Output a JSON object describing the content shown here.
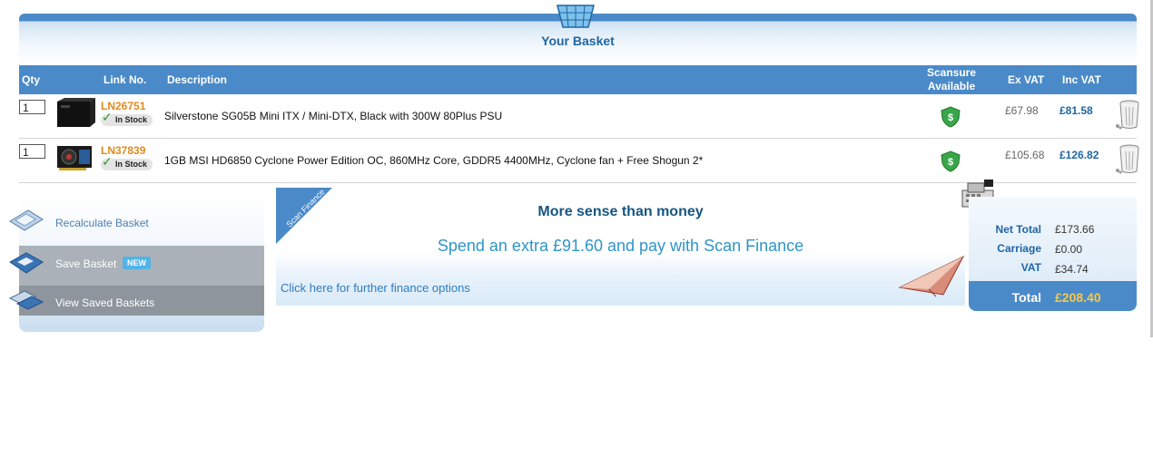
{
  "header": {
    "title": "Your Basket"
  },
  "table": {
    "columns": {
      "qty": "Qty",
      "link_no": "Link No.",
      "description": "Description",
      "scansure": "Scansure Available",
      "ex_vat": "Ex VAT",
      "inc_vat": "Inc VAT"
    },
    "rows": [
      {
        "qty": "1",
        "link_no": "LN26751",
        "stock": "In Stock",
        "description": "Silverstone SG05B Mini ITX / Mini-DTX, Black with 300W 80Plus PSU",
        "ex_vat": "£67.98",
        "inc_vat": "£81.58"
      },
      {
        "qty": "1",
        "link_no": "LN37839",
        "stock": "In Stock",
        "description": "1GB MSI HD6850 Cyclone Power Edition OC, 860MHz Core, GDDR5 4400MHz, Cyclone fan + Free Shogun 2*",
        "ex_vat": "£105.68",
        "inc_vat": "£126.82"
      }
    ]
  },
  "side": {
    "recalculate": "Recalculate Basket",
    "save": "Save Basket",
    "save_badge": "NEW",
    "view_saved": "View Saved Baskets"
  },
  "finance": {
    "corner_label": "Scan Finance",
    "headline": "More sense than money",
    "offer": "Spend an extra £91.60 and pay with Scan Finance",
    "link": "Click here for further finance options"
  },
  "totals": {
    "net_label": "Net Total",
    "net_value": "£173.66",
    "carriage_label": "Carriage",
    "carriage_value": "£0.00",
    "vat_label": "VAT",
    "vat_value": "£34.74",
    "total_label": "Total",
    "total_value": "£208.40"
  },
  "colors": {
    "header_blue": "#4a8ac8",
    "link_orange": "#e08a1e",
    "price_blue": "#1f65a5",
    "total_gold": "#f5c84a"
  },
  "icons": {
    "basket": "basket-icon",
    "shield": "scansure-shield-icon",
    "bin": "remove-bin-icon",
    "calculator": "calculator-icon",
    "disk": "save-disk-icon",
    "folder": "saved-baskets-icon",
    "register": "cash-register-icon",
    "plane": "paper-plane-icon"
  }
}
